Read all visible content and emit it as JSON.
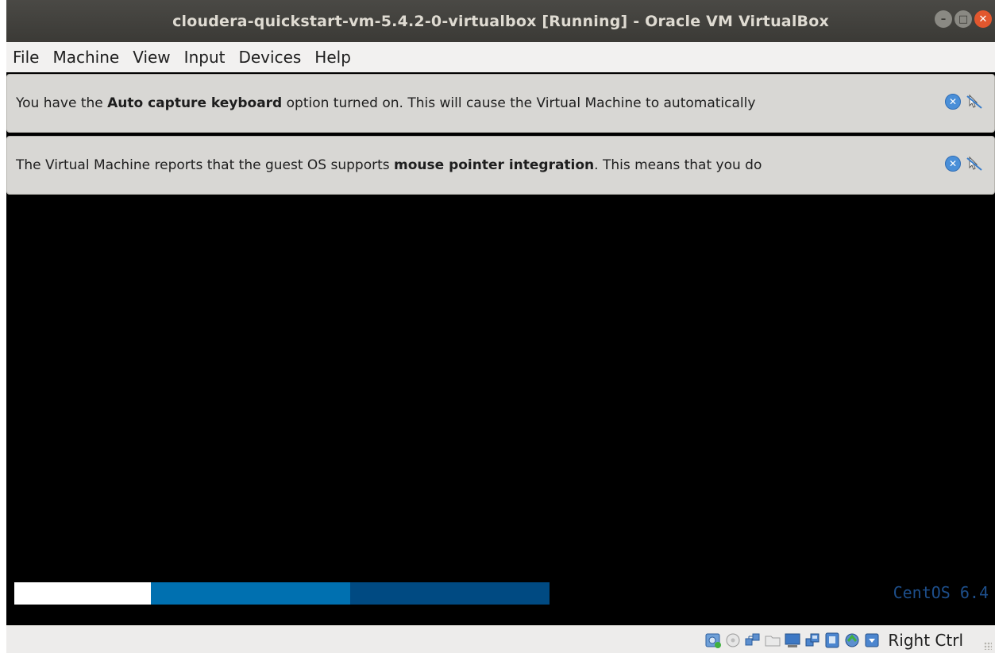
{
  "window": {
    "title": "cloudera-quickstart-vm-5.4.2-0-virtualbox [Running] - Oracle VM VirtualBox",
    "buttons": [
      "minimize-icon",
      "maximize-icon",
      "close-icon"
    ],
    "close_glyph": "✕",
    "min_glyph": "–",
    "max_glyph": "□"
  },
  "menubar": {
    "items": [
      {
        "label": "File"
      },
      {
        "label": "Machine"
      },
      {
        "label": "View"
      },
      {
        "label": "Input"
      },
      {
        "label": "Devices"
      },
      {
        "label": "Help"
      }
    ]
  },
  "notices": [
    {
      "prefix": "You have the ",
      "bold": "Auto capture keyboard",
      "suffix": " option turned on. This will cause the Virtual Machine to automatically"
    },
    {
      "prefix": "The Virtual Machine reports that the guest OS supports ",
      "bold": "mouse pointer integration",
      "suffix": ". This means that you do"
    }
  ],
  "guest_screen": {
    "os_label": "CentOS 6.4"
  },
  "statusbar": {
    "icons": [
      "hard-disk-icon",
      "optical-drive-icon",
      "network-icon",
      "shared-folders-icon",
      "display-icon",
      "usb-icon",
      "video-capture-icon",
      "mouse-integration-icon",
      "keyboard-capture-icon"
    ],
    "host_key": "Right Ctrl"
  },
  "colors": {
    "accent_blue": "#0070b0",
    "dark_blue": "#004a82",
    "close_orange": "#e2572e"
  }
}
